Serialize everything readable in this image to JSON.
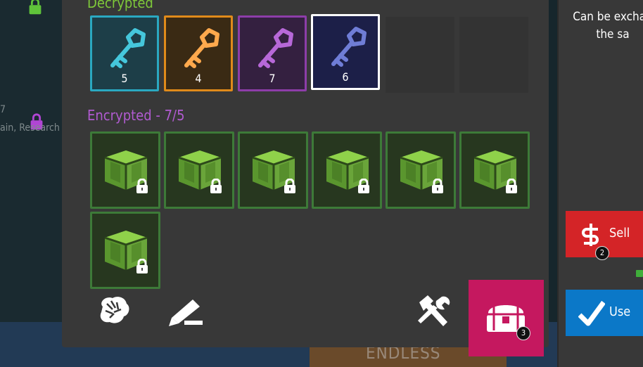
{
  "background": {
    "left_number": "7",
    "left_text": "ain, Research",
    "banner_text": "ENDLESS"
  },
  "decrypted": {
    "title": "Decrypted",
    "keys": [
      {
        "icon": "key-icon",
        "color": "#45c7dc",
        "bg": "#1d3e48",
        "border": "#2aa8c1",
        "count": "5"
      },
      {
        "icon": "key-icon",
        "color": "#ffa94d",
        "bg": "#3a2a14",
        "border": "#e08a1a",
        "count": "4"
      },
      {
        "icon": "key-icon",
        "color": "#b768d8",
        "bg": "#342040",
        "border": "#8d3da9",
        "count": "7"
      },
      {
        "icon": "key-icon",
        "color": "#6f7dd6",
        "bg": "#1c1f48",
        "border": "#ffffff",
        "count": "6"
      }
    ]
  },
  "encrypted": {
    "title": "Encrypted - 7/5",
    "crates": [
      "crate-1",
      "crate-2",
      "crate-3",
      "crate-4",
      "crate-5",
      "crate-6",
      "crate-7"
    ]
  },
  "chest_badge": "3",
  "right_panel": {
    "description_line1": "Can be exchan",
    "description_line2": "the sa",
    "sell_label": "Sell",
    "sell_badge": "2",
    "use_label": "Use"
  },
  "colors": {
    "decrypted_title": "#7ec83a",
    "encrypted_title": "#b15bd1",
    "sell": "#d42427",
    "use": "#0b78c8",
    "chest": "#c5185f"
  }
}
